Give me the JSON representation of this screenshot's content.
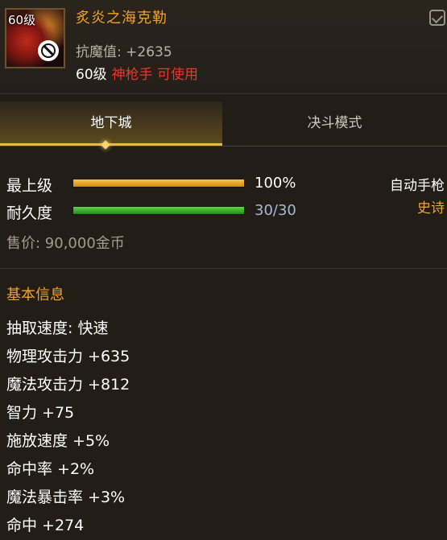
{
  "item": {
    "level_badge": "60级",
    "name": "炙炎之海克勒",
    "resist": "抗魔值: +2635",
    "req_level": "60级",
    "req_class": "神枪手 可使用",
    "type": "自动手枪",
    "rarity": "史诗",
    "rarity_color": "#e8a53a",
    "name_color": "#f0a32a",
    "icons": [
      "item-portrait",
      "no-symbol-icon",
      "compare-icon"
    ]
  },
  "tabs": [
    {
      "label": "地下城",
      "active": true
    },
    {
      "label": "决斗模式",
      "active": false
    }
  ],
  "stats": {
    "grade_label": "最上级",
    "grade_value": "100%",
    "grade_fraction": 1.0,
    "durability_label": "耐久度",
    "durability_value": "30/30",
    "durability_fraction": 1.0
  },
  "price": "售价: 90,000金币",
  "section_title": "基本信息",
  "attributes": [
    "抽取速度: 快速",
    "物理攻击力 +635",
    "魔法攻击力 +812",
    "智力 +75",
    "施放速度 +5%",
    "命中率 +2%",
    "魔法暴击率 +3%",
    "命中 +274"
  ]
}
